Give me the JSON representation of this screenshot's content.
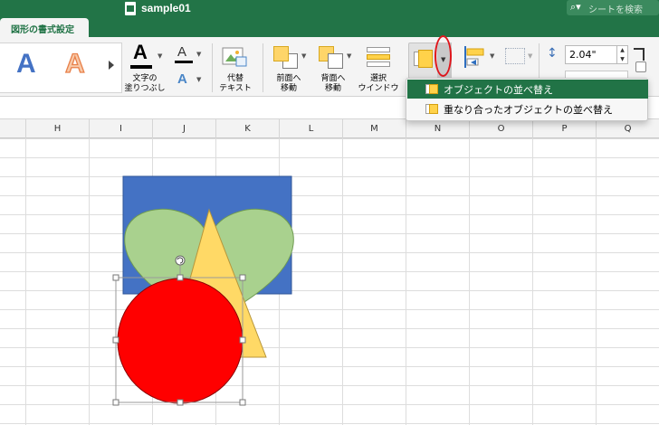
{
  "window": {
    "title": "sample01",
    "search_placeholder": "シートを検索"
  },
  "ribbon": {
    "active_tab": "図形の書式設定",
    "shape_styles": {
      "sample_a": "A",
      "sample_b": "A"
    },
    "text_fill": {
      "label_line1": "文字の",
      "label_line2": "塗りつぶし",
      "glyph": "A"
    },
    "text_outline": {
      "glyph": "A"
    },
    "text_effects": {
      "glyph": "A"
    },
    "alt_text": {
      "label_line1": "代替",
      "label_line2": "テキスト"
    },
    "bring_forward": {
      "label_line1": "前面へ",
      "label_line2": "移動"
    },
    "send_backward": {
      "label_line1": "背面へ",
      "label_line2": "移動"
    },
    "selection_pane": {
      "label_line1": "選択",
      "label_line2": "ウインドウ"
    },
    "size": {
      "height_value": "2.04\""
    },
    "colors": {
      "accent": "#227447",
      "highlight_circle": "#e0161c"
    }
  },
  "arrange_menu": {
    "items": [
      {
        "label": "オブジェクトの並べ替え",
        "selected": true
      },
      {
        "label": "重なり合ったオブジェクトの並べ替え",
        "selected": false
      }
    ]
  },
  "sheet": {
    "columns": [
      "H",
      "I",
      "J",
      "K",
      "L",
      "M",
      "N",
      "O",
      "P",
      "Q"
    ],
    "shapes": {
      "rectangle_color": "#4472c4",
      "heart_color": "#a9d18e",
      "triangle_color": "#ffd966",
      "circle_color": "#ff0000",
      "selected_shape": "circle"
    }
  }
}
